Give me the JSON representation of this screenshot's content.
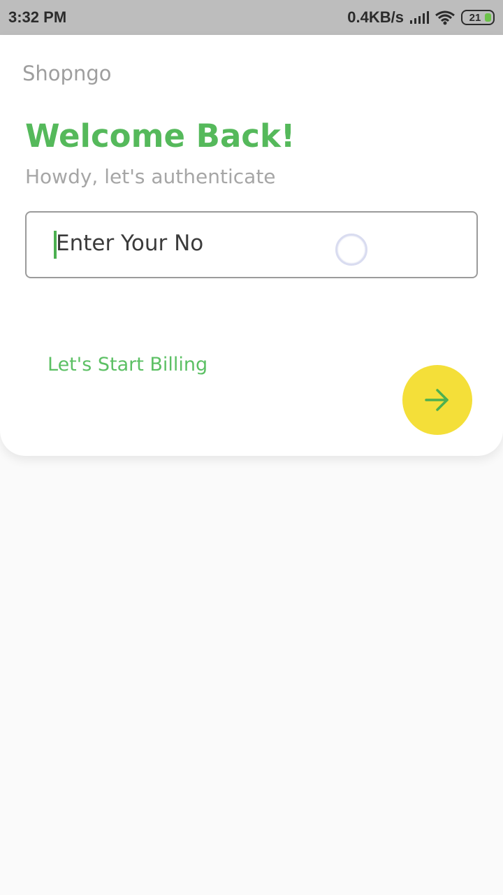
{
  "status_bar": {
    "time": "3:32 PM",
    "network_speed": "0.4KB/s",
    "battery_level": "21",
    "icons": [
      "signal-icon",
      "wifi-icon",
      "battery-icon"
    ]
  },
  "header": {
    "app_name": "Shopngo"
  },
  "login": {
    "title": "Welcome Back!",
    "subtitle": "Howdy, let's authenticate",
    "phone_placeholder": "Enter Your No",
    "billing_link": "Let's Start Billing"
  },
  "colors": {
    "accent_green": "#55b95b",
    "button_yellow": "#f4df39",
    "status_bar_bg": "#bdbdbd",
    "page_bg": "#fafafa"
  }
}
